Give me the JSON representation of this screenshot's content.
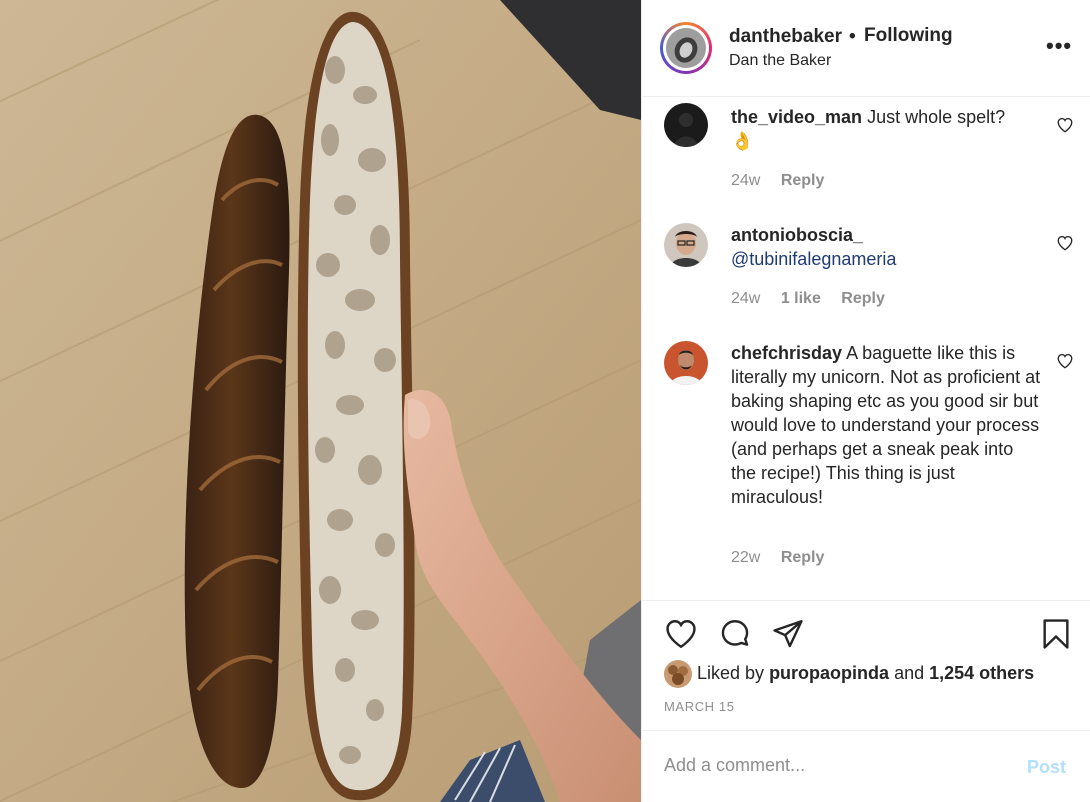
{
  "post": {
    "username": "danthebaker",
    "separator": "•",
    "follow_status": "Following",
    "full_name": "Dan the Baker",
    "more_icon": "more-horizontal-icon",
    "more_label": "•••"
  },
  "photo": {
    "subject": "two baguettes on a wooden cutting board, one sliced lengthwise held by a hand"
  },
  "comments": [
    {
      "username": "the_video_man",
      "text": "Just whole spelt?",
      "emoji": "👌",
      "time": "24w",
      "likes": "",
      "reply": "Reply"
    },
    {
      "username": "antonioboscia_",
      "text": "",
      "mention": "@tubinifalegnameria",
      "time": "24w",
      "likes": "1 like",
      "reply": "Reply"
    },
    {
      "username": "chefchrisday",
      "text": "A baguette like this is literally my unicorn. Not as proficient at baking shaping etc as you good sir but would love to understand your process (and perhaps get a sneak peak into the recipe!) This thing is just miraculous!",
      "time": "22w",
      "likes": "",
      "reply": "Reply"
    }
  ],
  "actions": {
    "like_icon": "heart-icon",
    "comment_icon": "comment-icon",
    "share_icon": "share-icon",
    "save_icon": "bookmark-icon"
  },
  "likes": {
    "prefix": "Liked by",
    "user": "puropaopinda",
    "middle": "and",
    "count": "1,254 others"
  },
  "date": "MARCH 15",
  "add_comment": {
    "placeholder": "Add a comment...",
    "post_label": "Post"
  },
  "colors": {
    "text": "#262626",
    "secondary": "#8e8e8e",
    "mention": "#1f3b73",
    "post_disabled": "#b2dffc",
    "divider": "#efefef"
  }
}
